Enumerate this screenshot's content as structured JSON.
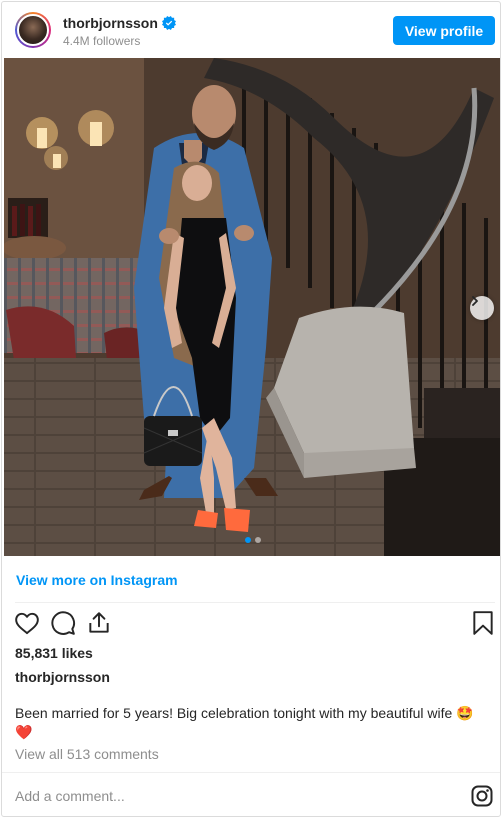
{
  "header": {
    "username": "thorbjornsson",
    "followers": "4.4M followers",
    "view_profile_label": "View profile"
  },
  "post": {
    "image_alt": "Couple posing on staircase",
    "carousel_count": 2,
    "carousel_active_index": 0
  },
  "links": {
    "view_more": "View more on Instagram"
  },
  "stats": {
    "likes": "85,831 likes"
  },
  "caption": {
    "owner": "thorbjornsson",
    "text": "Been married for 5 years! Big celebration tonight with my beautiful wife 🤩 ❤️",
    "view_comments": "View all 513 comments"
  },
  "comment_box": {
    "placeholder": "Add a comment..."
  },
  "colors": {
    "accent": "#0095f6",
    "muted": "#8e8e8e",
    "text": "#262626"
  },
  "icons": [
    "verified-badge-icon",
    "heart-icon",
    "comment-icon",
    "share-icon",
    "bookmark-icon",
    "chevron-right-icon",
    "instagram-logo-icon"
  ]
}
